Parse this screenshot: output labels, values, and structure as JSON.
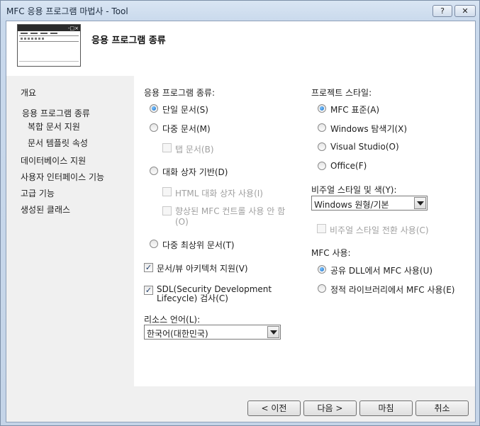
{
  "window": {
    "title": "MFC 응용 프로그램 마법사 - Tool",
    "help_label": "?",
    "close_label": "✕"
  },
  "header": {
    "title": "응용 프로그램 종류"
  },
  "nav": {
    "items": [
      "개요",
      "응용 프로그램 종류",
      "복합 문서 지원",
      "문서 템플릿 속성",
      "데이터베이스 지원",
      "사용자 인터페이스 기능",
      "고급 기능",
      "생성된 클래스"
    ]
  },
  "app_type": {
    "label": "응용 프로그램 종류:",
    "single": "단일 문서(S)",
    "multi": "다중 문서(M)",
    "tabbed": "탭 문서(B)",
    "dialog": "대화 상자 기반(D)",
    "html_dialog": "HTML 대화 상자 사용(I)",
    "no_enhanced": "향상된 MFC 컨트롤 사용 안 함(O)",
    "multi_top": "다중 최상위 문서(T)",
    "docview": "문서/뷰 아키텍처 지원(V)",
    "sdl": "SDL(Security Development Lifecycle) 검사(C)"
  },
  "resource": {
    "label": "리소스 언어(L):",
    "value": "한국어(대한민국)"
  },
  "project_style": {
    "label": "프로젝트 스타일:",
    "mfc_std": "MFC 표준(A)",
    "explorer": "Windows 탐색기(X)",
    "vs": "Visual Studio(O)",
    "office": "Office(F)"
  },
  "visual_style": {
    "label": "비주얼 스타일 및 색(Y):",
    "value": "Windows 원형/기본",
    "switch": "비주얼 스타일 전환 사용(C)"
  },
  "mfc_use": {
    "label": "MFC 사용:",
    "shared": "공유 DLL에서 MFC 사용(U)",
    "static": "정적 라이브러리에서 MFC 사용(E)"
  },
  "buttons": {
    "prev": "< 이전",
    "next": "다음 >",
    "finish": "마침",
    "cancel": "취소"
  }
}
